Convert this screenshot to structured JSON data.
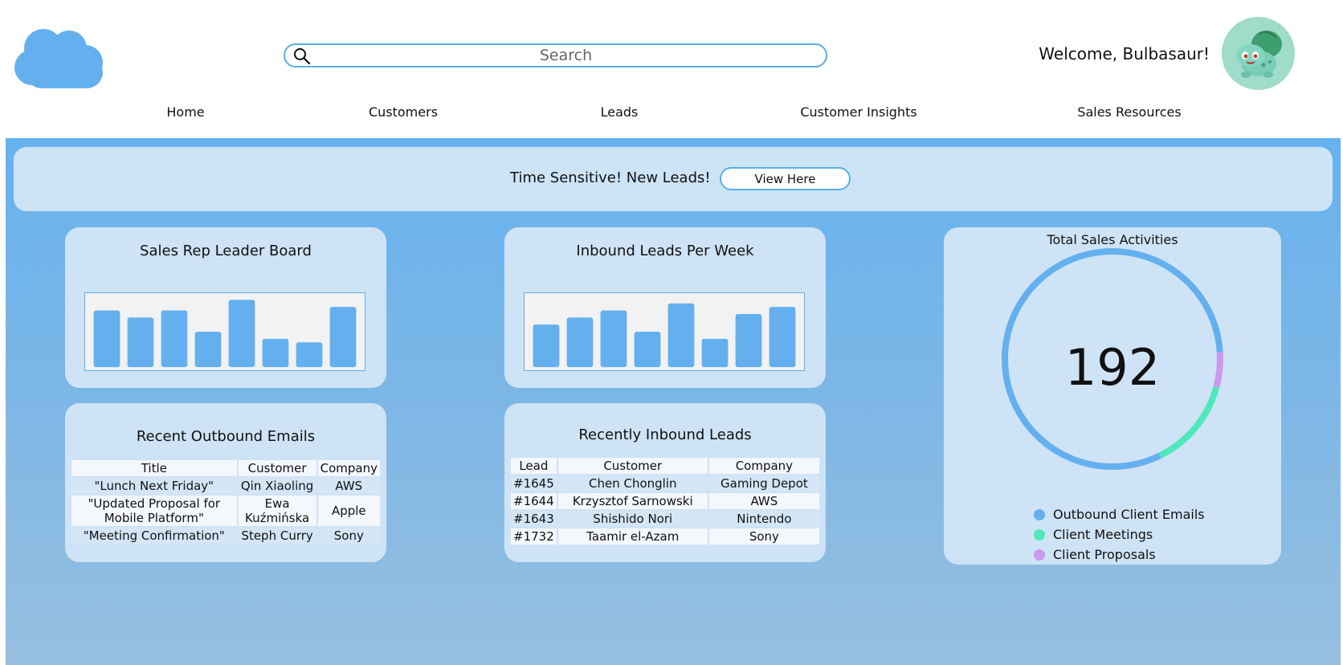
{
  "header": {
    "search_placeholder": "Search",
    "welcome": "Welcome, Bulbasaur!"
  },
  "nav": [
    {
      "label": "Home"
    },
    {
      "label": "Customers"
    },
    {
      "label": "Leads"
    },
    {
      "label": "Customer Insights"
    },
    {
      "label": "Sales Resources"
    }
  ],
  "banner": {
    "message": "Time Sensitive! New Leads!",
    "button": "View Here"
  },
  "leaderboard": {
    "title": "Sales Rep Leader Board"
  },
  "inbound_chart": {
    "title": "Inbound Leads Per Week"
  },
  "outbound_emails": {
    "title": "Recent Outbound Emails",
    "headers": [
      "Title",
      "Customer",
      "Company"
    ],
    "rows": [
      [
        "\"Lunch Next Friday\"",
        "Qin Xiaoling",
        "AWS"
      ],
      [
        "\"Updated Proposal for Mobile Platform\"",
        "Ewa Kuźmińska",
        "Apple"
      ],
      [
        "\"Meeting Confirmation\"",
        "Steph Curry",
        "Sony"
      ]
    ]
  },
  "inbound_leads": {
    "title": "Recently Inbound Leads",
    "headers": [
      "Lead",
      "Customer",
      "Company"
    ],
    "rows": [
      [
        "#1645",
        "Chen Chonglin",
        "Gaming Depot"
      ],
      [
        "#1644",
        "Krzysztof Sarnowski",
        "AWS"
      ],
      [
        "#1643",
        "Shishido Nori",
        "Nintendo"
      ],
      [
        "#1732",
        "Taamir el-Azam",
        "Sony"
      ]
    ]
  },
  "sales_activities": {
    "title": "Total Sales Activities",
    "total": "192"
  },
  "colors": {
    "accent": "#64b0ee",
    "emails": "#64b0ee",
    "meetings": "#4fe8b8",
    "proposals": "#cc99ee"
  },
  "chart_data": [
    {
      "type": "bar",
      "title": "Sales Rep Leader Board",
      "categories": [
        "",
        "",
        "",
        "",
        "",
        "",
        "",
        ""
      ],
      "values": [
        8,
        7,
        8,
        5,
        9.5,
        4,
        3.5,
        8.5
      ],
      "ylim": [
        0,
        10
      ]
    },
    {
      "type": "bar",
      "title": "Inbound Leads Per Week",
      "categories": [
        "",
        "",
        "",
        "",
        "",
        "",
        "",
        ""
      ],
      "values": [
        6,
        7,
        8,
        5,
        9,
        4,
        7.5,
        8.5
      ],
      "ylim": [
        0,
        10
      ]
    },
    {
      "type": "pie",
      "title": "Total Sales Activities",
      "center_label": "192",
      "series": [
        {
          "name": "Outbound Client Emails",
          "value": 156,
          "color": "#64b0ee"
        },
        {
          "name": "Client Meetings",
          "value": 26,
          "color": "#4fe8b8"
        },
        {
          "name": "Client Proposals",
          "value": 10,
          "color": "#cc99ee"
        }
      ]
    }
  ]
}
